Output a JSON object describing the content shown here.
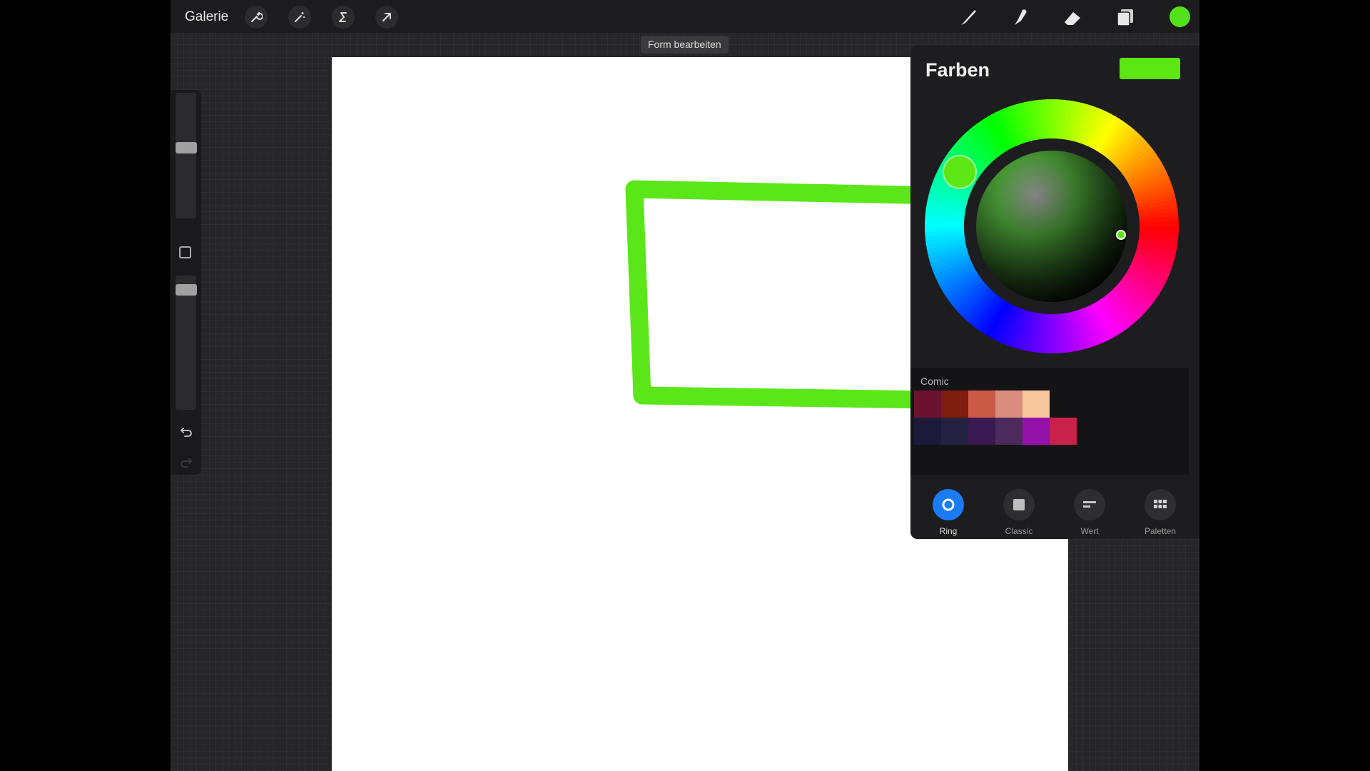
{
  "toolbar": {
    "gallery_label": "Galerie",
    "left_tools": [
      "wrench-icon",
      "magic-wand-icon",
      "selection-s-icon",
      "arrow-transform-icon"
    ],
    "right_tools": [
      "brush-icon",
      "smudge-icon",
      "eraser-icon",
      "layers-icon"
    ],
    "current_color": "#52e21c"
  },
  "hint": {
    "text": "Form bearbeiten"
  },
  "canvas": {
    "stroke_color": "#5be61a"
  },
  "colors_panel": {
    "title": "Farben",
    "current_color": "#5ce614",
    "palette": {
      "name": "Comic",
      "row1": [
        "#6a1230",
        "#7e1c0e",
        "#c95a46",
        "#d88d7e",
        "#f5c79a"
      ],
      "row2": [
        "#1c1a38",
        "#242240",
        "#3a1850",
        "#4c2a5c",
        "#9512a8",
        "#c8214a"
      ]
    },
    "tabs": [
      {
        "label": "Ring",
        "icon": "ring-icon",
        "active": true
      },
      {
        "label": "Classic",
        "icon": "classic-square-icon",
        "active": false
      },
      {
        "label": "Wert",
        "icon": "value-bars-icon",
        "active": false
      },
      {
        "label": "Paletten",
        "icon": "palettes-grid-icon",
        "active": false
      }
    ]
  }
}
